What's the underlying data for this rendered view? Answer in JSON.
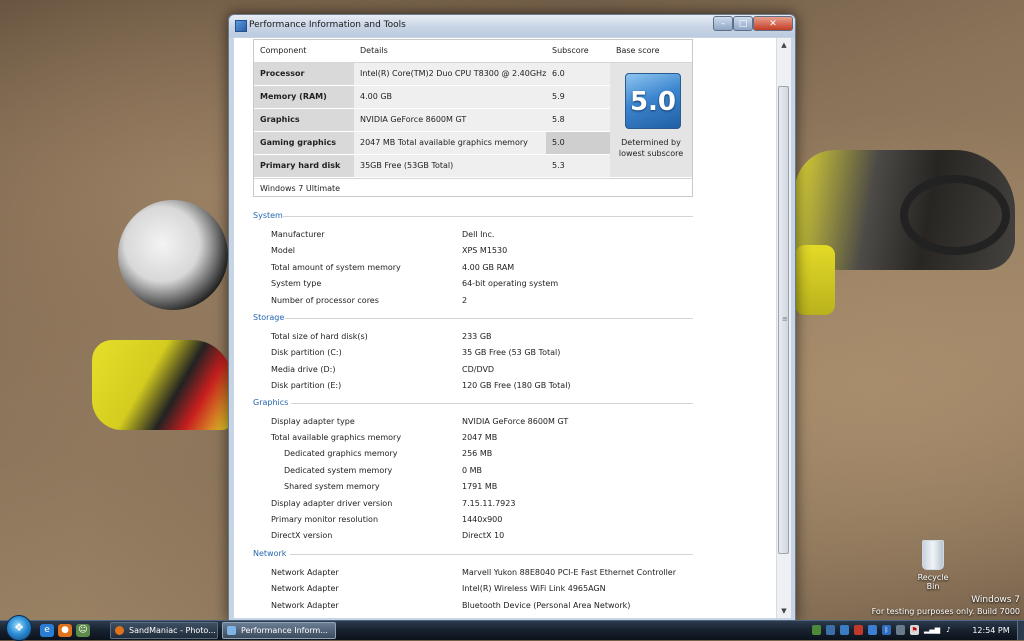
{
  "window": {
    "title": "Performance Information and Tools",
    "controls": {
      "minimize": "–",
      "maximize": "□",
      "close": "✕"
    }
  },
  "score_table": {
    "headers": {
      "component": "Component",
      "details": "Details",
      "subscore": "Subscore",
      "base": "Base score"
    },
    "rows": [
      {
        "component": "Processor",
        "details": "Intel(R) Core(TM)2 Duo CPU T8300 @ 2.40GHz",
        "subscore": "6.0"
      },
      {
        "component": "Memory (RAM)",
        "details": "4.00 GB",
        "subscore": "5.9"
      },
      {
        "component": "Graphics",
        "details": "NVIDIA GeForce 8600M GT",
        "subscore": "5.8"
      },
      {
        "component": "Gaming graphics",
        "details": "2047 MB Total available graphics memory",
        "subscore": "5.0"
      },
      {
        "component": "Primary hard disk",
        "details": "35GB Free (53GB Total)",
        "subscore": "5.3"
      }
    ],
    "base_score": "5.0",
    "base_caption": "Determined by lowest subscore",
    "edition": "Windows 7 Ultimate"
  },
  "sections": {
    "system": {
      "title": "System",
      "items": [
        {
          "label": "Manufacturer",
          "value": "Dell Inc."
        },
        {
          "label": "Model",
          "value": "XPS M1530"
        },
        {
          "label": "Total amount of system memory",
          "value": "4.00 GB RAM"
        },
        {
          "label": "System type",
          "value": "64-bit operating system"
        },
        {
          "label": "Number of processor cores",
          "value": "2"
        }
      ]
    },
    "storage": {
      "title": "Storage",
      "items": [
        {
          "label": "Total size of hard disk(s)",
          "value": "233 GB"
        },
        {
          "label": "Disk partition (C:)",
          "value": "35 GB Free (53 GB Total)"
        },
        {
          "label": "Media drive (D:)",
          "value": "CD/DVD"
        },
        {
          "label": "Disk partition (E:)",
          "value": "120 GB Free (180 GB Total)"
        }
      ]
    },
    "graphics": {
      "title": "Graphics",
      "items": [
        {
          "label": "Display adapter type",
          "value": "NVIDIA GeForce 8600M GT"
        },
        {
          "label": "Total available graphics memory",
          "value": "2047 MB"
        },
        {
          "label": "Dedicated graphics memory",
          "value": "256 MB"
        },
        {
          "label": "Dedicated system memory",
          "value": "0 MB"
        },
        {
          "label": "Shared system memory",
          "value": "1791 MB"
        },
        {
          "label": "Display adapter driver version",
          "value": "7.15.11.7923"
        },
        {
          "label": "Primary monitor resolution",
          "value": "1440x900"
        },
        {
          "label": "DirectX version",
          "value": "DirectX 10"
        }
      ]
    },
    "network": {
      "title": "Network",
      "items": [
        {
          "label": "Network Adapter",
          "value": "Marvell Yukon 88E8040 PCI-E Fast Ethernet Controller"
        },
        {
          "label": "Network Adapter",
          "value": "Intel(R) Wireless WiFi Link 4965AGN"
        },
        {
          "label": "Network Adapter",
          "value": "Bluetooth Device (Personal Area Network)"
        }
      ]
    }
  },
  "taskbar": {
    "tasks": [
      {
        "label": "SandManiac - Photo...",
        "icon": "firefox-icon"
      },
      {
        "label": "Performance Inform...",
        "icon": "performance-icon"
      }
    ],
    "clock": "12:54 PM"
  },
  "desktop": {
    "recycle_bin": "Recycle Bin",
    "watermark_line1": "Windows 7",
    "watermark_line2": "For testing purposes only. Build 7000"
  },
  "colors": {
    "section_heading": "#2466b0",
    "badge": "#3d86cf",
    "close_button": "#c33c25"
  }
}
